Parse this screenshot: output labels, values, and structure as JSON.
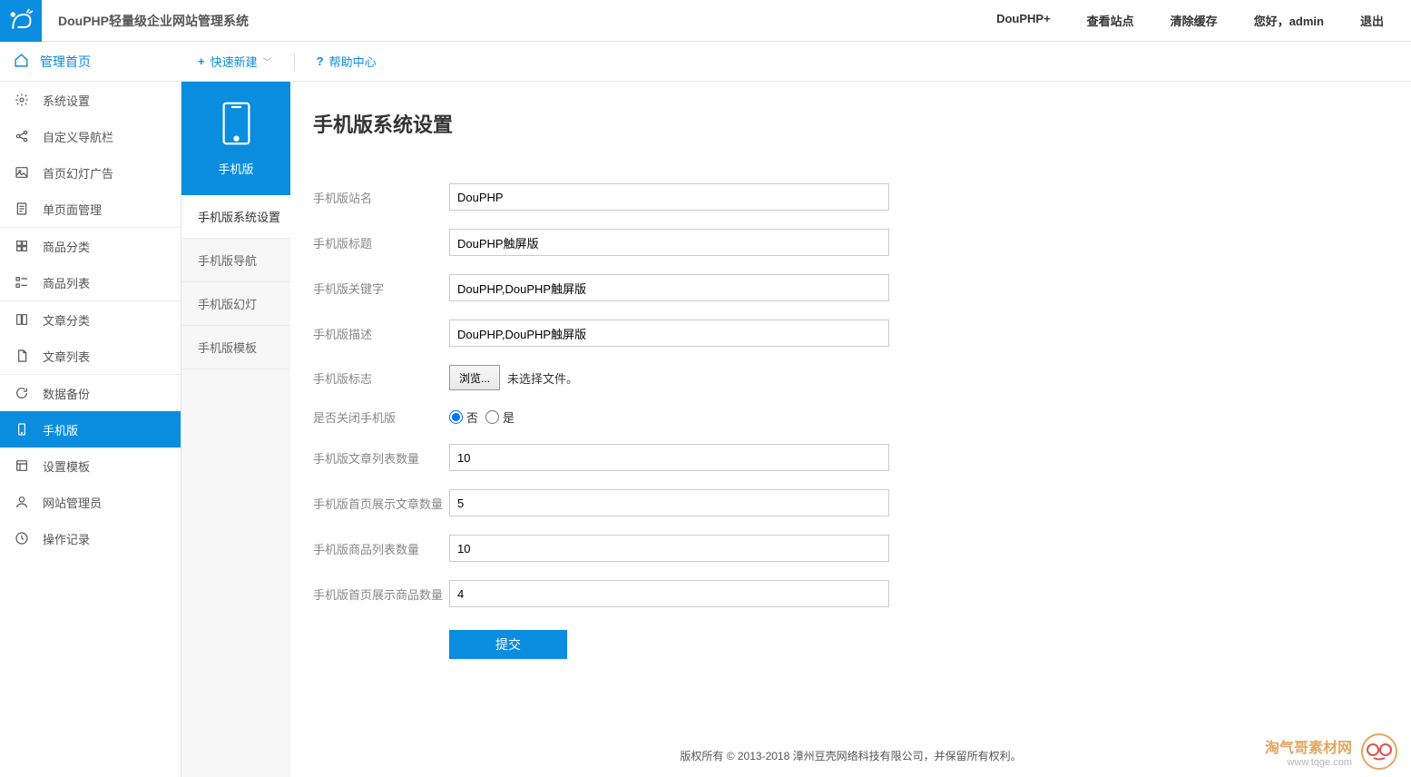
{
  "header": {
    "brand": "DouPHP轻量级企业网站管理系统",
    "links": {
      "plus": "DouPHP+",
      "view_site": "查看站点",
      "clear_cache": "清除缓存",
      "greeting": "您好，admin",
      "logout": "退出"
    }
  },
  "toolbar": {
    "home": "管理首页",
    "quick_new": "快速新建",
    "help": "帮助中心"
  },
  "sidebar": {
    "items": [
      "系统设置",
      "自定义导航栏",
      "首页幻灯广告",
      "单页面管理",
      "商品分类",
      "商品列表",
      "文章分类",
      "文章列表",
      "数据备份",
      "手机版",
      "设置模板",
      "网站管理员",
      "操作记录"
    ]
  },
  "subnav": {
    "tab": "手机版",
    "items": [
      "手机版系统设置",
      "手机版导航",
      "手机版幻灯",
      "手机版模板"
    ]
  },
  "page": {
    "title": "手机版系统设置",
    "form": {
      "site_name_label": "手机版站名",
      "site_name_value": "DouPHP",
      "title_label": "手机版标题",
      "title_value": "DouPHP触屏版",
      "keywords_label": "手机版关键字",
      "keywords_value": "DouPHP,DouPHP触屏版",
      "desc_label": "手机版描述",
      "desc_value": "DouPHP,DouPHP触屏版",
      "logo_label": "手机版标志",
      "browse_btn": "浏览...",
      "no_file": "未选择文件。",
      "close_label": "是否关闭手机版",
      "radio_no": "否",
      "radio_yes": "是",
      "article_list_label": "手机版文章列表数量",
      "article_list_value": "10",
      "home_article_label": "手机版首页展示文章数量",
      "home_article_value": "5",
      "product_list_label": "手机版商品列表数量",
      "product_list_value": "10",
      "home_product_label": "手机版首页展示商品数量",
      "home_product_value": "4",
      "submit": "提交"
    }
  },
  "footer": "版权所有 © 2013-2018 漳州豆壳网络科技有限公司，并保留所有权利。",
  "watermark": {
    "cn": "淘气哥素材网",
    "en": "www.tqge.com"
  }
}
